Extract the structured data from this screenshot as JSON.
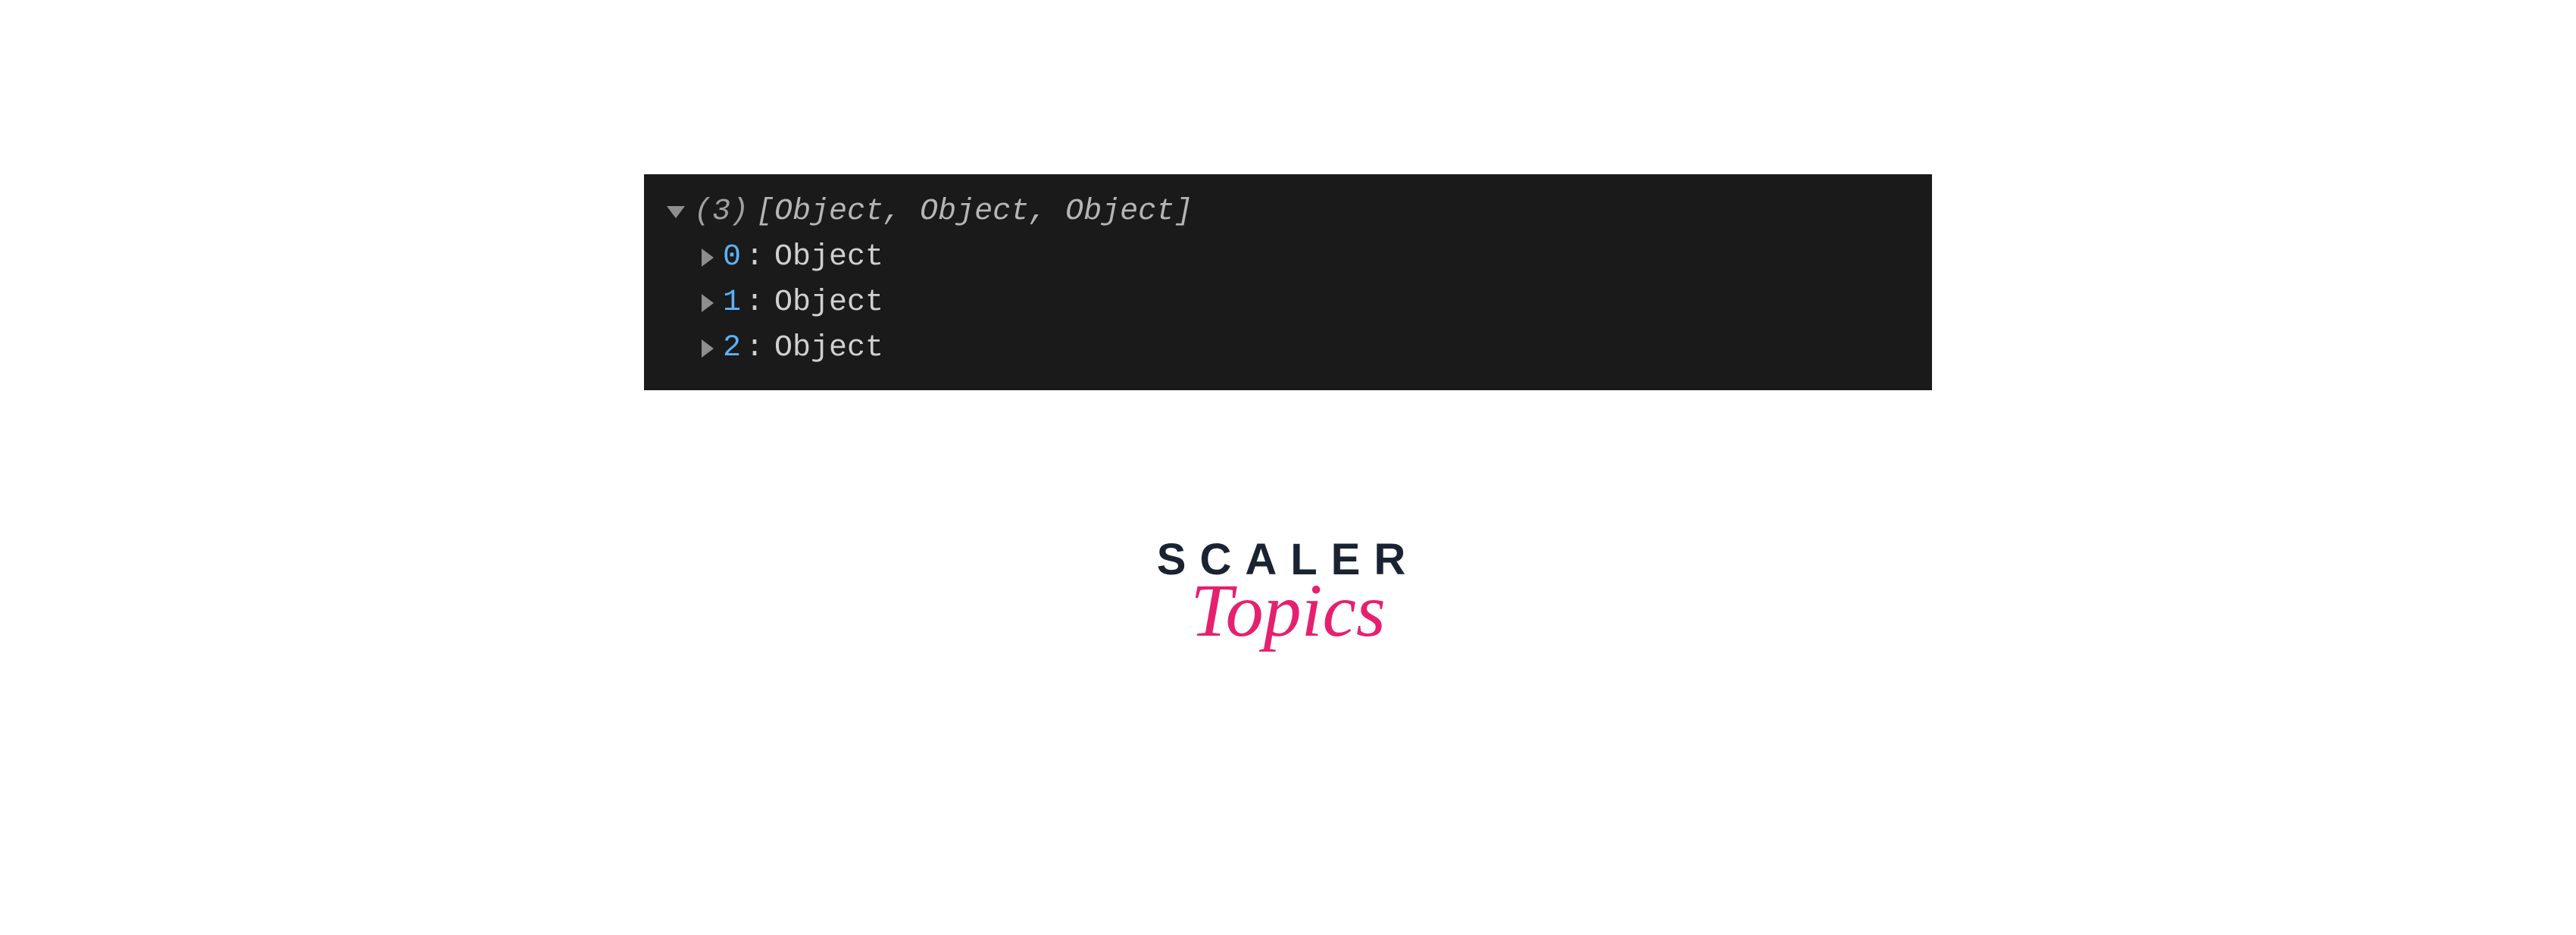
{
  "console": {
    "rootArrow": "expanded",
    "count": "(3)",
    "preview": "[Object, Object, Object]",
    "items": [
      {
        "index": "0",
        "colon": ":",
        "value": "Object"
      },
      {
        "index": "1",
        "colon": ":",
        "value": "Object"
      },
      {
        "index": "2",
        "colon": ":",
        "value": "Object"
      }
    ]
  },
  "logo": {
    "line1": "SCALER",
    "line2": "Topics"
  }
}
